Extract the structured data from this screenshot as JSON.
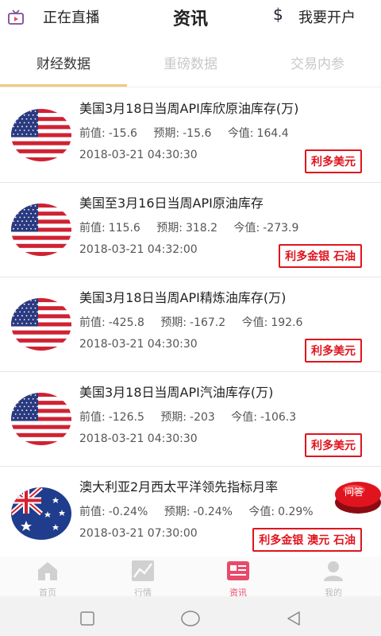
{
  "header": {
    "live_text": "正在直播",
    "title": "资讯",
    "dollar_symbol": "$",
    "open_account": "我要开户"
  },
  "tabs": [
    {
      "label": "财经数据",
      "active": true
    },
    {
      "label": "重磅数据",
      "active": false
    },
    {
      "label": "交易内参",
      "active": false
    }
  ],
  "labels": {
    "prev": "前值:",
    "forecast": "预期:",
    "actual": "今值:"
  },
  "items": [
    {
      "title": "美国3月18日当周API库欣原油库存(万)",
      "prev": "-15.6",
      "forecast": "-15.6",
      "actual": "164.4",
      "date": "2018-03-21 04:30:30",
      "tag": "利多美元",
      "flag": "us-flag-icon"
    },
    {
      "title": "美国至3月16日当周API原油库存",
      "prev": "115.6",
      "forecast": "318.2",
      "actual": "-273.9",
      "date": "2018-03-21 04:32:00",
      "tag": "利多金银 石油",
      "flag": "us-flag-icon"
    },
    {
      "title": "美国3月18日当周API精炼油库存(万)",
      "prev": "-425.8",
      "forecast": "-167.2",
      "actual": "192.6",
      "date": "2018-03-21 04:30:30",
      "tag": "利多美元",
      "flag": "us-flag-icon"
    },
    {
      "title": "美国3月18日当周API汽油库存(万)",
      "prev": "-126.5",
      "forecast": "-203",
      "actual": "-106.3",
      "date": "2018-03-21 04:30:30",
      "tag": "利多美元",
      "flag": "us-flag-icon"
    },
    {
      "title": "澳大利亚2月西太平洋领先指标月率",
      "prev": "-0.24%",
      "forecast": "-0.24%",
      "actual": "0.29%",
      "date": "2018-03-21 07:30:00",
      "tag": "利多金银 澳元 石油",
      "flag": "australia-flag-icon"
    }
  ],
  "ask_button": {
    "label": "问答"
  },
  "bottom_nav": [
    {
      "label": "首页",
      "icon": "home-icon",
      "active": false
    },
    {
      "label": "行情",
      "icon": "chart-icon",
      "active": false
    },
    {
      "label": "资讯",
      "icon": "news-icon",
      "active": true
    },
    {
      "label": "我的",
      "icon": "user-icon",
      "active": false
    }
  ],
  "colors": {
    "accent": "#e84a6b",
    "tag_red": "#e0141e",
    "tab_underline": "#f0c880"
  }
}
